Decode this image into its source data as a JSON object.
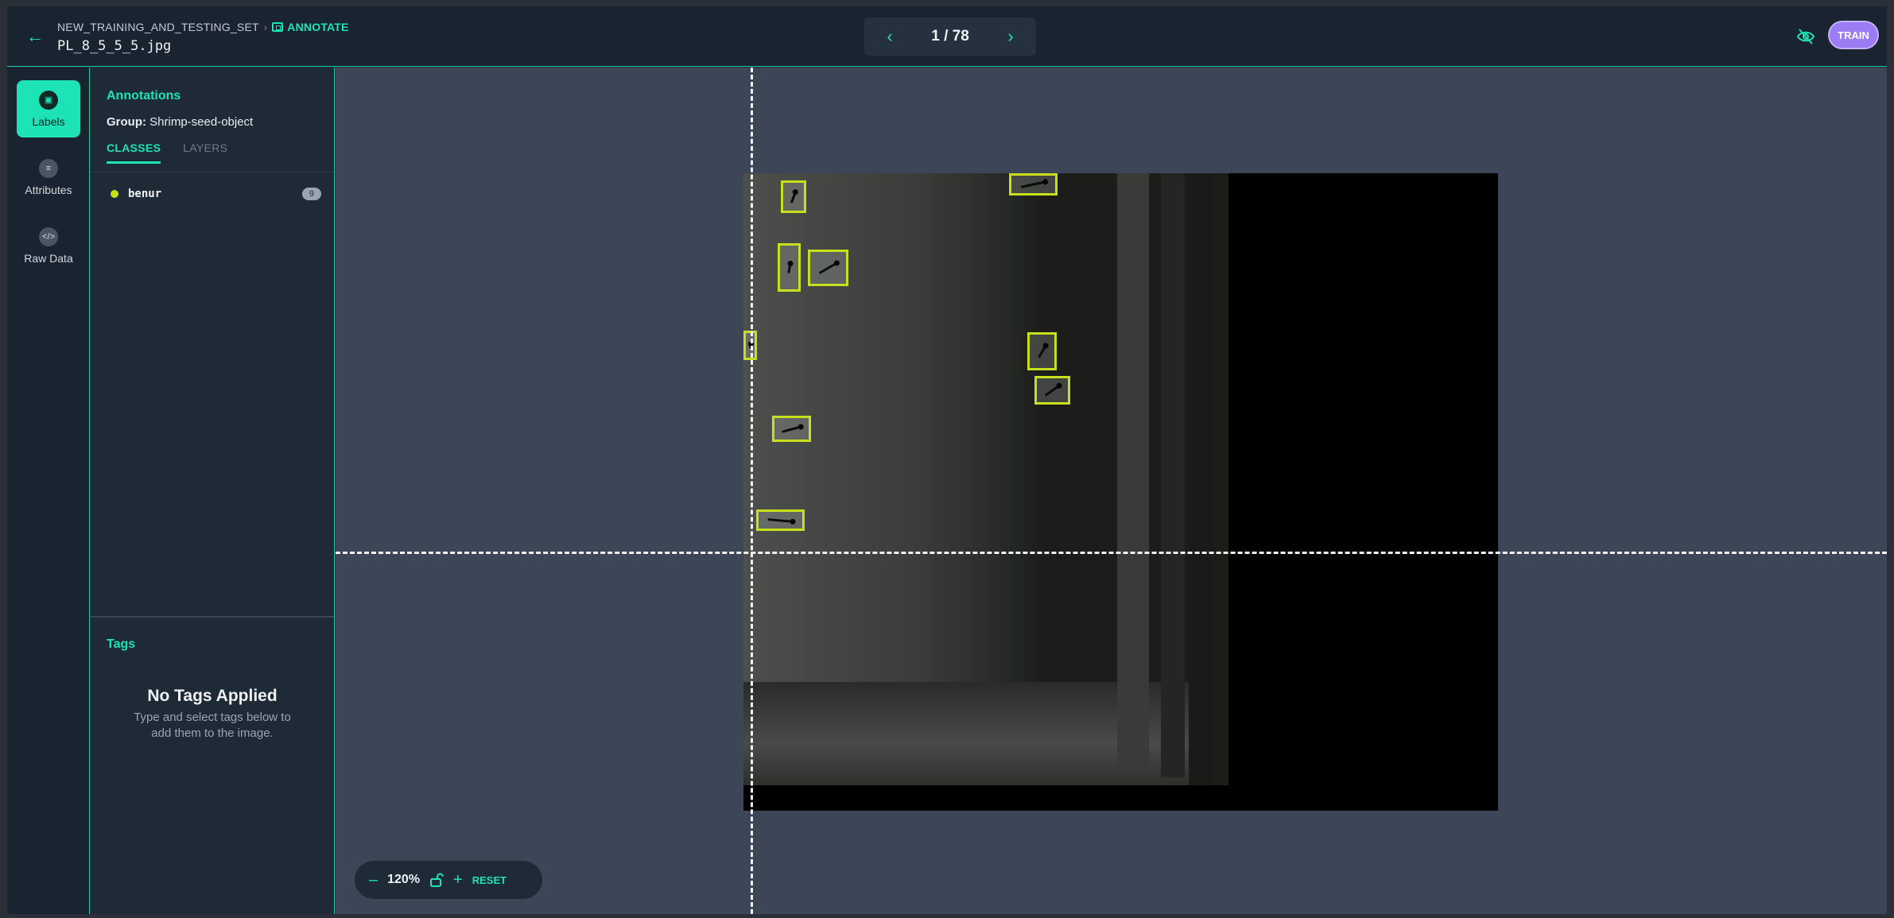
{
  "header": {
    "breadcrumb_parent": "NEW_TRAINING_AND_TESTING_SET",
    "breadcrumb_current": "ANNOTATE",
    "filename": "PL_8_5_5_5.jpg",
    "pager": {
      "current": 1,
      "total": 78,
      "display": "1 / 78"
    },
    "train_label": "TRAIN"
  },
  "rail": {
    "items": [
      {
        "label": "Labels",
        "icon": "label-icon",
        "active": true
      },
      {
        "label": "Attributes",
        "icon": "list-icon",
        "active": false
      },
      {
        "label": "Raw Data",
        "icon": "code-icon",
        "active": false
      }
    ]
  },
  "panel": {
    "title": "Annotations",
    "group_prefix": "Group:",
    "group_name": "Shrimp-seed-object",
    "tabs": [
      {
        "label": "CLASSES",
        "active": true
      },
      {
        "label": "LAYERS",
        "active": false
      }
    ],
    "classes": [
      {
        "name": "benur",
        "count": "9",
        "color": "#c8e01b"
      }
    ],
    "tags": {
      "title": "Tags",
      "empty_title": "No Tags Applied",
      "empty_desc": "Type and select tags below to add them to the image."
    }
  },
  "canvas": {
    "zoom": "120%",
    "reset_label": "RESET",
    "bbox_color": "#c8e01b"
  },
  "colors": {
    "accent": "#1ee3b6",
    "train": "#9b7cf5",
    "class_benur": "#c8e01b"
  }
}
